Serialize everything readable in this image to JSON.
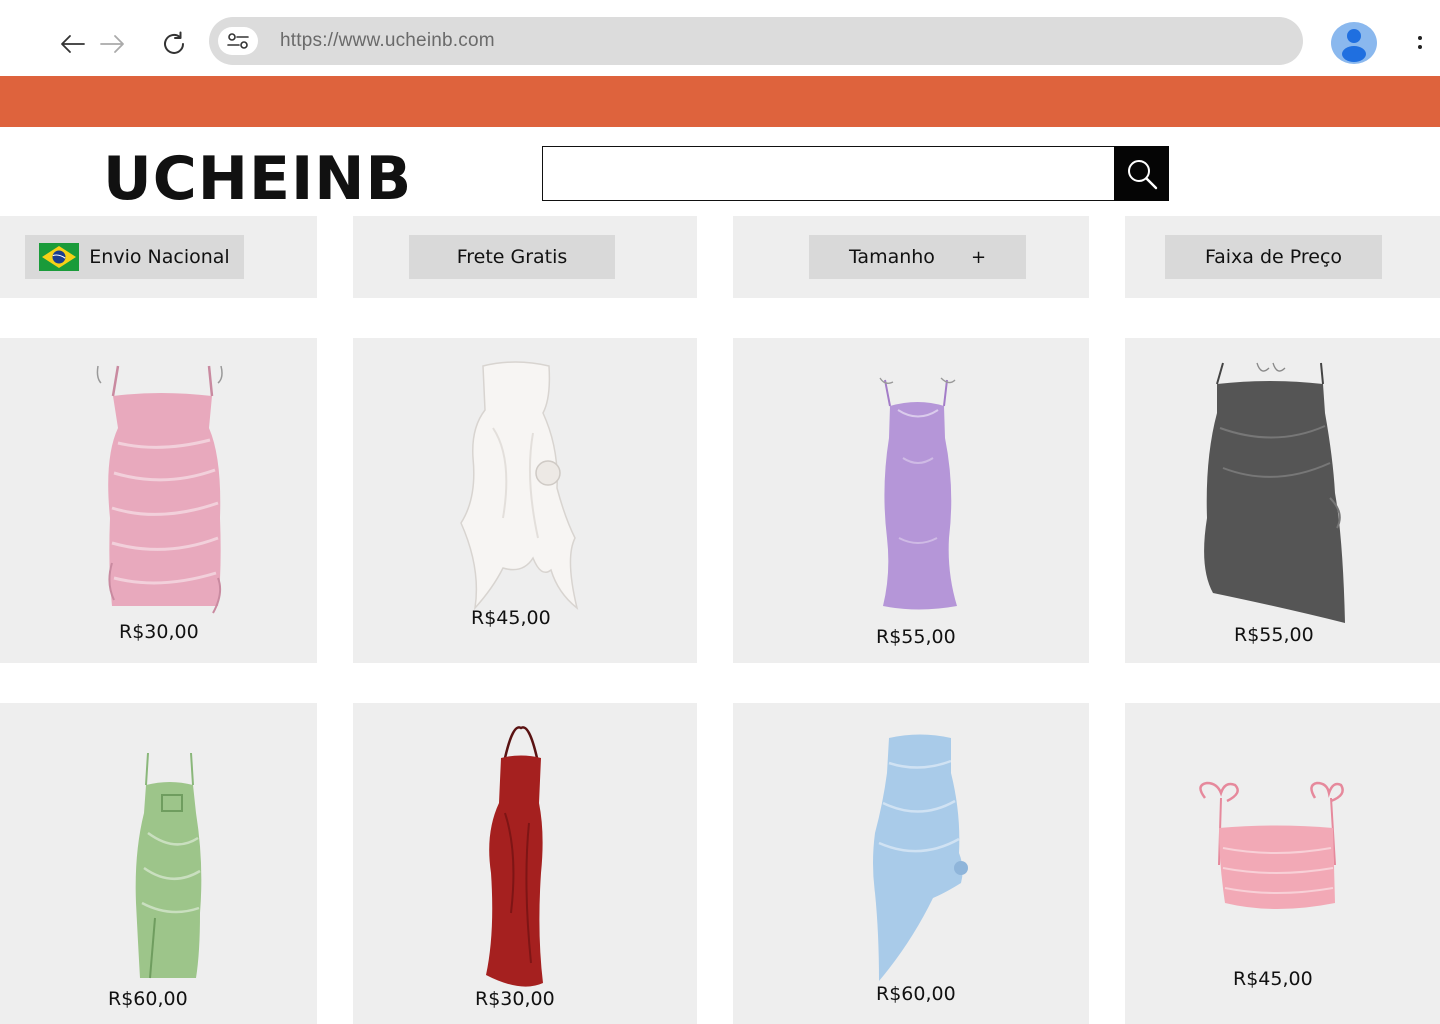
{
  "browser": {
    "url": "https://www.ucheinb.com",
    "icons": {
      "back": "arrow-left-icon",
      "forward": "arrow-right-icon",
      "reload": "reload-icon",
      "site_settings": "tune-icon",
      "profile": "profile-icon",
      "menu": "more-vert-icon"
    }
  },
  "colors": {
    "banner": "#de633d",
    "card_bg": "#eeeeee",
    "filter_button_bg": "#d9d9d9"
  },
  "header": {
    "logo": "UCHEINB",
    "search": {
      "placeholder": "",
      "button_icon": "search-icon"
    }
  },
  "filters": [
    {
      "label": "Envio Nacional",
      "icon": "brazil-flag-icon"
    },
    {
      "label": "Frete Gratis"
    },
    {
      "label": "Tamanho",
      "suffix": "+"
    },
    {
      "label": "Faixa de Preço"
    }
  ],
  "products": [
    {
      "price": "R$30,00",
      "image": "pink-satin-ruched-dress",
      "color": "#e8a9bd"
    },
    {
      "price": "R$45,00",
      "image": "white-ruffle-rose-dress",
      "color": "#f7f5f3"
    },
    {
      "price": "R$55,00",
      "image": "lilac-mermaid-maxi-dress",
      "color": "#b596d8"
    },
    {
      "price": "R$55,00",
      "image": "gray-ruched-mini-dress",
      "color": "#555555"
    },
    {
      "price": "R$60,00",
      "image": "green-satin-slit-dress",
      "color": "#9dc58a"
    },
    {
      "price": "R$30,00",
      "image": "red-halter-maxi-dress",
      "color": "#a5201f"
    },
    {
      "price": "R$60,00",
      "image": "blue-strapless-asymmetric-dress",
      "color": "#a9cbe9"
    },
    {
      "price": "R$45,00",
      "image": "pink-tie-strap-top",
      "color": "#f2a9b6"
    }
  ]
}
